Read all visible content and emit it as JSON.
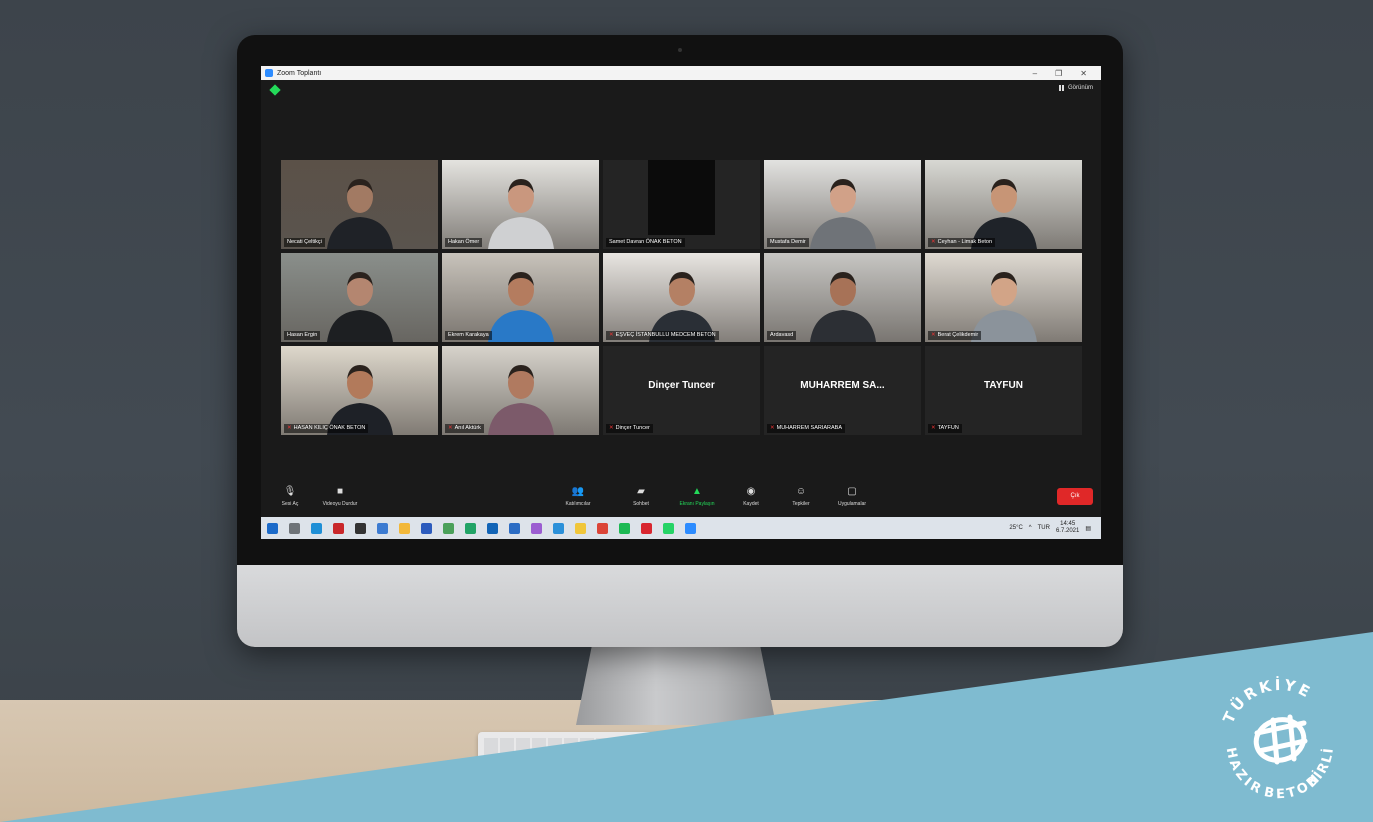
{
  "window": {
    "title": "Zoom Toplantı"
  },
  "topbar": {
    "view_label": "Görünüm"
  },
  "participants": [
    {
      "name": "Necati Çeltikçi",
      "type": "video",
      "bg": "#5b5148",
      "skin": "#a27a63",
      "shirt": "#1f2227",
      "mic_muted": false
    },
    {
      "name": "Hakan Ömer",
      "type": "video",
      "bg": "#e4e3df",
      "skin": "#c9977e",
      "shirt": "#cfd0d2",
      "mic_muted": false,
      "active": true
    },
    {
      "name": "Samet Davran ÖNAK BETON",
      "type": "blank",
      "mic_muted": false
    },
    {
      "name": "Mustafa Demir",
      "type": "video",
      "bg": "#e2e2e0",
      "skin": "#d1a188",
      "shirt": "#6f7378",
      "mic_muted": false
    },
    {
      "name": "Ceyhan - Limak Beton",
      "type": "video",
      "bg": "#d8d8d3",
      "skin": "#c79576",
      "shirt": "#1f2329",
      "mic_muted": true
    },
    {
      "name": "Hasan Ergin",
      "type": "video",
      "bg": "#8a8f8b",
      "skin": "#b48670",
      "shirt": "#1d1f22",
      "mic_muted": false
    },
    {
      "name": "Ekrem Karakaya",
      "type": "video",
      "bg": "#c8c3bb",
      "skin": "#b47c5f",
      "shirt": "#2979c7",
      "mic_muted": false
    },
    {
      "name": "EŞVEÇ İSTANBULLU MEDCEM BETON",
      "type": "video",
      "bg": "#e8e5e1",
      "skin": "#b48064",
      "shirt": "#2a2f36",
      "mic_muted": true
    },
    {
      "name": "Ardavasd",
      "type": "video",
      "bg": "#c7c6c3",
      "skin": "#a77257",
      "shirt": "#2c2f34",
      "mic_muted": false
    },
    {
      "name": "Berat Çelikdemir",
      "type": "video",
      "bg": "#ded9d1",
      "skin": "#d2a487",
      "shirt": "#8b939b",
      "mic_muted": true
    },
    {
      "name": "HASAN KILIÇ ÖNAK BETON",
      "type": "video",
      "bg": "#ded8cc",
      "skin": "#b27a5b",
      "shirt": "#1e2127",
      "mic_muted": true
    },
    {
      "name": "Anıl Aktürk",
      "type": "video",
      "bg": "#d7d3cb",
      "skin": "#b07a60",
      "shirt": "#7c5a6a",
      "mic_muted": true
    },
    {
      "name": "Dinçer Tuncer",
      "type": "name",
      "display": "Dinçer Tuncer",
      "mic_muted": true
    },
    {
      "name": "MUHARREM SARIARABA",
      "type": "name",
      "display": "MUHARREM  SA...",
      "mic_muted": true
    },
    {
      "name": "TAYFUN",
      "type": "name",
      "display": "TAYFUN",
      "mic_muted": true
    }
  ],
  "controls": {
    "mute": "Sesi Aç",
    "video": "Videoyu Durdur",
    "participants": "Katılımcılar",
    "participants_count": "15",
    "chat": "Sohbet",
    "share": "Ekranı Paylaşın",
    "record": "Kaydet",
    "reactions": "Tepkiler",
    "apps": "Uygulamalar",
    "leave": "Çık"
  },
  "taskbar": {
    "weather": "25°C",
    "lang": "TUR",
    "time": "14:45",
    "date": "6.7.2021",
    "icons": [
      {
        "name": "start",
        "color": "#1b6ac9"
      },
      {
        "name": "search",
        "color": "#6e7378"
      },
      {
        "name": "edge",
        "color": "#1f8fd6"
      },
      {
        "name": "filezilla",
        "color": "#c9272a"
      },
      {
        "name": "chrome-dark",
        "color": "#333333"
      },
      {
        "name": "paint",
        "color": "#3c7bd1"
      },
      {
        "name": "folder",
        "color": "#f2b83a"
      },
      {
        "name": "save",
        "color": "#2c5bbd"
      },
      {
        "name": "notepad",
        "color": "#4aa05a"
      },
      {
        "name": "excel",
        "color": "#21a366"
      },
      {
        "name": "outlook",
        "color": "#1264b6"
      },
      {
        "name": "word",
        "color": "#2b6cc4"
      },
      {
        "name": "snip",
        "color": "#9b5dd1"
      },
      {
        "name": "photos",
        "color": "#2b90d9"
      },
      {
        "name": "sticky",
        "color": "#f0c63a"
      },
      {
        "name": "chrome",
        "color": "#db4437"
      },
      {
        "name": "spotify",
        "color": "#1db954"
      },
      {
        "name": "acrobat",
        "color": "#d8262f"
      },
      {
        "name": "whatsapp",
        "color": "#25d366"
      },
      {
        "name": "zoom",
        "color": "#2d8cff"
      }
    ]
  },
  "brand": {
    "top": "TÜRKİYE",
    "left": "HAZIR",
    "bottom": "BETON",
    "right": "BİRLİĞİ",
    "accent": "#7fbbd0"
  }
}
